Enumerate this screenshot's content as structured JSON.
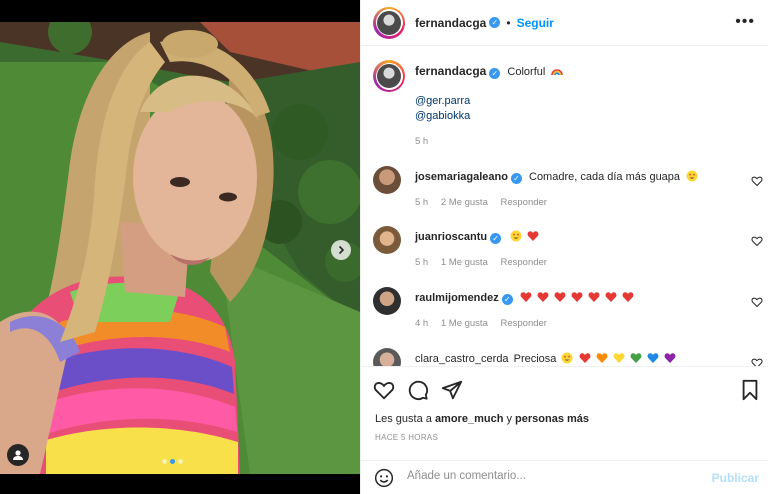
{
  "post": {
    "author": "fernandacga",
    "follow_label": "Seguir",
    "separator": "•",
    "more_label": "•••",
    "verified_mark": "✓"
  },
  "caption": {
    "username": "fernandacga",
    "text": "Colorful",
    "mentions": [
      "@ger.parra",
      "@gabiokka"
    ],
    "time": "5 h"
  },
  "comments": [
    {
      "username": "josemariagaleano",
      "verified": true,
      "text": "Comadre, cada día más guapa",
      "time": "5 h",
      "likes": "2 Me gusta",
      "reply": "Responder"
    },
    {
      "username": "juanrioscantu",
      "verified": true,
      "text": "",
      "time": "5 h",
      "likes": "1 Me gusta",
      "reply": "Responder"
    },
    {
      "username": "raulmijomendez",
      "verified": true,
      "text": "",
      "time": "4 h",
      "likes": "1 Me gusta",
      "reply": "Responder"
    },
    {
      "username": "clara_castro_cerda",
      "verified": false,
      "text": "Preciosa",
      "time": "",
      "likes": "",
      "reply": ""
    }
  ],
  "likes_line": {
    "prefix": "Les gusta a",
    "user": "amore_much",
    "connector": "y",
    "suffix": "personas más"
  },
  "time_ago": "HACE 5 HORAS",
  "add_comment": {
    "placeholder": "Añade un comentario...",
    "post_label": "Publicar"
  },
  "icons": {
    "like": "heart-icon",
    "comment": "comment-icon",
    "share": "share-icon",
    "save": "bookmark-icon",
    "emoji": "emoji-icon",
    "tag": "user-tag-icon",
    "next": "chevron-right-icon",
    "more": "more-options-icon"
  },
  "colors": {
    "accent": "#0095f6",
    "verified": "#3897f0",
    "heart_red": "#ed4956",
    "publish_disabled": "#b2dffc"
  },
  "carousel": {
    "count": 3,
    "active": 2
  }
}
